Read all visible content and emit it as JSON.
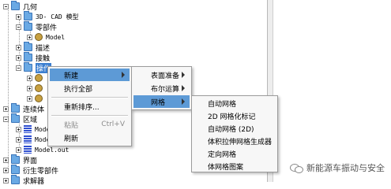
{
  "tree": {
    "nodes": [
      {
        "label": "几何"
      },
      {
        "label": "3D- CAD 模型"
      },
      {
        "label": "零部件"
      },
      {
        "label": "Model"
      },
      {
        "label": "描述"
      },
      {
        "label": "接触"
      },
      {
        "label": "操作"
      },
      {
        "label": "连续体"
      },
      {
        "label": "区域"
      },
      {
        "label": "Model"
      },
      {
        "label": "Model"
      },
      {
        "label": "Model.out"
      },
      {
        "label": "界面"
      },
      {
        "label": "衍生零部件"
      },
      {
        "label": "求解器"
      }
    ]
  },
  "context_menu": {
    "items": [
      {
        "label": "新建",
        "has_submenu": true,
        "highlighted": true
      },
      {
        "label": "执行全部"
      },
      {
        "label": "重新排序..."
      },
      {
        "label": "粘贴",
        "shortcut": "Ctrl+V",
        "disabled": true
      },
      {
        "label": "刷新"
      }
    ]
  },
  "submenu_new": {
    "items": [
      {
        "label": "表面准备",
        "has_submenu": true
      },
      {
        "label": "布尔运算",
        "has_submenu": true
      },
      {
        "label": "网格",
        "has_submenu": true,
        "highlighted": true
      }
    ]
  },
  "submenu_mesh": {
    "items": [
      {
        "label": "自动网格"
      },
      {
        "label": "2D 网格化标记"
      },
      {
        "label": "自动网格 (2D)"
      },
      {
        "label": "体积拉伸网格生成器"
      },
      {
        "label": "定向网格"
      },
      {
        "label": "体网格图案"
      }
    ]
  },
  "watermark": {
    "text": "新能源车振动与安全"
  },
  "colors": {
    "highlight": "#5d9ad6",
    "folder": "#6aa9e4"
  }
}
